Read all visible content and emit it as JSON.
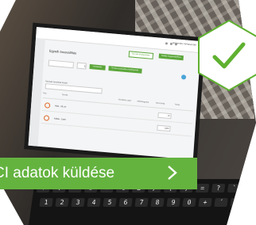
{
  "cta": {
    "label": "CI adatok küldése",
    "arrow_icon": "chevron-right-icon"
  },
  "badge": {
    "icon": "check-icon",
    "color": "#5fb130"
  },
  "screen": {
    "page_title": "Egyedi összeállítás",
    "top_buttons": [
      "Termék kiválasztása",
      "Küldés megrendelésre"
    ],
    "user_label": "Ismeretlen felhasználó",
    "controls": {
      "quantity_value": "1",
      "add_button": "Hozzáadás",
      "secondary_button": "Termék hozzáadása katalógusból"
    },
    "search_label": "Keresés termékek között",
    "table": {
      "headers": [
        "Kép",
        "Termék",
        "Rendelési szám",
        "Mértékegység",
        "Mennyiség",
        "Törlés"
      ],
      "rows": [
        {
          "name": "Háló - 35 cm",
          "quantity": "10"
        },
        {
          "name": "Kellék - Szett",
          "quantity": "1000"
        }
      ]
    }
  },
  "keyboard": {
    "row1": [
      "+",
      "!",
      "\"",
      "#",
      "¤",
      "%",
      "&",
      "/",
      "(",
      ")",
      "=",
      "?",
      "`"
    ],
    "row2": [
      "1",
      "2",
      "3",
      "4",
      "5",
      "6",
      "7",
      "8",
      "9",
      "0",
      "+",
      "´",
      "←"
    ]
  },
  "colors": {
    "accent_green": "#64b33f",
    "check_green": "#5fb130"
  }
}
